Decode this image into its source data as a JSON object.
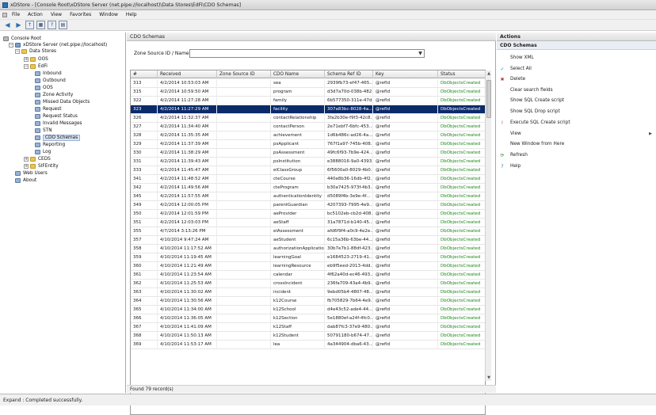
{
  "window": {
    "title": "xDStore - [Console Root\\xDStore Server (net.pipe://localhost)\\Data Stores\\EdFi\\CDO Schemas]"
  },
  "menu": [
    "File",
    "Action",
    "View",
    "Favorites",
    "Window",
    "Help"
  ],
  "tree": [
    {
      "label": "Console Root",
      "level": 0,
      "icon": "root"
    },
    {
      "label": "xDStore Server (net.pipe://localhost)",
      "level": 1,
      "icon": "server"
    },
    {
      "label": "Data Stores",
      "level": 2,
      "icon": "folder"
    },
    {
      "label": "OOS",
      "level": 3,
      "icon": "folder"
    },
    {
      "label": "EdFi",
      "level": 3,
      "icon": "folder"
    },
    {
      "label": "Inbound",
      "level": 4,
      "icon": "item"
    },
    {
      "label": "Outbound",
      "level": 4,
      "icon": "item"
    },
    {
      "label": "OOS",
      "level": 4,
      "icon": "item"
    },
    {
      "label": "Zone Activity",
      "level": 4,
      "icon": "item"
    },
    {
      "label": "Missed Data Objects",
      "level": 4,
      "icon": "item"
    },
    {
      "label": "Request",
      "level": 4,
      "icon": "item"
    },
    {
      "label": "Request Status",
      "level": 4,
      "icon": "item"
    },
    {
      "label": "Invalid Messages",
      "level": 4,
      "icon": "item"
    },
    {
      "label": "STN",
      "level": 4,
      "icon": "item"
    },
    {
      "label": "CDO Schemas",
      "level": 4,
      "icon": "item",
      "selected": true
    },
    {
      "label": "Reporting",
      "level": 4,
      "icon": "item"
    },
    {
      "label": "Log",
      "level": 4,
      "icon": "item"
    },
    {
      "label": "CEDS",
      "level": 3,
      "icon": "folder"
    },
    {
      "label": "SIFEntity",
      "level": 3,
      "icon": "folder"
    },
    {
      "label": "Web Users",
      "level": 2,
      "icon": "item"
    },
    {
      "label": "About",
      "level": 2,
      "icon": "item"
    }
  ],
  "center": {
    "title": "CDO Schemas",
    "filter_label": "Zone Source ID / Name:",
    "filter_value": "",
    "found": "Found 79 record(s)"
  },
  "grid": {
    "columns": [
      "#",
      "Received",
      "Zone Source ID",
      "CDO Name",
      "Schema Ref ID",
      "Key",
      "Status"
    ],
    "rows": [
      [
        "313",
        "4/2/2014 10:53:03 AM",
        "",
        "sea",
        "2939fb73-ef47-465...",
        "@refId",
        "DbObjectsCreated"
      ],
      [
        "315",
        "4/2/2014 10:59:50 AM",
        "",
        "program",
        "d3d7a70d-038b-482...",
        "@refId",
        "DbObjectsCreated"
      ],
      [
        "322",
        "4/2/2014 11:27:28 AM",
        "",
        "family",
        "6b577350-311e-47d...",
        "@refId",
        "DbObjectsCreated"
      ],
      [
        "323",
        "4/2/2014 11:27:29 AM",
        "",
        "facility",
        "307a83bc-8028-4a...",
        "@refId",
        "DbObjectsCreated"
      ],
      [
        "326",
        "4/2/2014 11:32:37 AM",
        "",
        "contactRelationship",
        "3fa2b30e-f9f3-42c8...",
        "@refId",
        "DbObjectsCreated"
      ],
      [
        "327",
        "4/2/2014 11:34:40 AM",
        "",
        "contactPerson",
        "2e71ebf7-6bfc-453...",
        "@refId",
        "DbObjectsCreated"
      ],
      [
        "328",
        "4/2/2014 11:35:35 AM",
        "",
        "achievement",
        "1d6b486c-ad26-4a...",
        "@refId",
        "DbObjectsCreated"
      ],
      [
        "329",
        "4/2/2014 11:37:39 AM",
        "",
        "psApplicant",
        "767f1a97-745b-408...",
        "@refId",
        "DbObjectsCreated"
      ],
      [
        "330",
        "4/2/2014 11:38:29 AM",
        "",
        "psAssessment",
        "49fc6f93-7b9e-424...",
        "@refId",
        "DbObjectsCreated"
      ],
      [
        "331",
        "4/2/2014 11:39:43 AM",
        "",
        "psInstitution",
        "e3888016-9a0-4393...",
        "@refId",
        "DbObjectsCreated"
      ],
      [
        "333",
        "4/2/2014 11:45:47 AM",
        "",
        "elClassGroup",
        "6f5600a0-8029-4b0...",
        "@refId",
        "DbObjectsCreated"
      ],
      [
        "341",
        "4/2/2014 11:48:52 AM",
        "",
        "cteCourse",
        "440e8b36-16db-4f2...",
        "@refId",
        "DbObjectsCreated"
      ],
      [
        "342",
        "4/2/2014 11:49:56 AM",
        "",
        "cteProgram",
        "b30a7425-973f-4b3...",
        "@refId",
        "DbObjectsCreated"
      ],
      [
        "345",
        "4/2/2014 11:57:55 AM",
        "",
        "authenticationIdentity",
        "d5089f4b-3e9e-4f...",
        "@refId",
        "DbObjectsCreated"
      ],
      [
        "349",
        "4/2/2014 12:00:05 PM",
        "",
        "parentGuardian",
        "4207393-7995-4e9...",
        "@refId",
        "DbObjectsCreated"
      ],
      [
        "350",
        "4/2/2014 12:01:59 PM",
        "",
        "aeProvider",
        "bc5102eb-cb2d-408...",
        "@refId",
        "DbObjectsCreated"
      ],
      [
        "351",
        "4/2/2014 12:03:03 PM",
        "",
        "aeStaff",
        "31a7871d-b140-45...",
        "@refId",
        "DbObjectsCreated"
      ],
      [
        "355",
        "4/7/2014 3:13:26 PM",
        "",
        "elAssessment",
        "afd6f9f4-a0c9-4e2e...",
        "@refId",
        "DbObjectsCreated"
      ],
      [
        "357",
        "4/10/2014 9:47:24 AM",
        "",
        "aeStudent",
        "6c15a36b-63be-44...",
        "@refId",
        "DbObjectsCreated"
      ],
      [
        "358",
        "4/10/2014 11:17:52 AM",
        "",
        "authorizationApplication",
        "30b7e7b1-88df-423...",
        "@refId",
        "DbObjectsCreated"
      ],
      [
        "359",
        "4/10/2014 11:19:45 AM",
        "",
        "learningGoal",
        "e1684523-2719-41...",
        "@refId",
        "DbObjectsCreated"
      ],
      [
        "360",
        "4/10/2014 11:21:49 AM",
        "",
        "learningResource",
        "eb9f5eed-2013-4dd...",
        "@refId",
        "DbObjectsCreated"
      ],
      [
        "361",
        "4/10/2014 11:23:54 AM",
        "",
        "calendar",
        "4f62a40d-ec46-493...",
        "@refId",
        "DbObjectsCreated"
      ],
      [
        "362",
        "4/10/2014 11:25:53 AM",
        "",
        "crossIncident",
        "236fa709-43a4-4b9...",
        "@refId",
        "DbObjectsCreated"
      ],
      [
        "363",
        "4/10/2014 11:30:02 AM",
        "",
        "incident",
        "9ebd05b4-4807-48...",
        "@refId",
        "DbObjectsCreated"
      ],
      [
        "364",
        "4/10/2014 11:30:56 AM",
        "",
        "k12Course",
        "fb705829-7b64-4e9...",
        "@refId",
        "DbObjectsCreated"
      ],
      [
        "365",
        "4/10/2014 11:34:00 AM",
        "",
        "k12School",
        "d4e43c52-ade4-44...",
        "@refId",
        "DbObjectsCreated"
      ],
      [
        "366",
        "4/10/2014 11:36:05 AM",
        "",
        "k12Section",
        "5e1880ef-a24f-4fc0...",
        "@refId",
        "DbObjectsCreated"
      ],
      [
        "367",
        "4/10/2014 11:41:09 AM",
        "",
        "k12Staff",
        "dab87fc3-37e9-480...",
        "@refId",
        "DbObjectsCreated"
      ],
      [
        "368",
        "4/10/2014 11:50:13 AM",
        "",
        "k12Student",
        "50791180-b674-47...",
        "@refId",
        "DbObjectsCreated"
      ],
      [
        "369",
        "4/10/2014 11:53:17 AM",
        "",
        "lea",
        "4a344904-dba6-43...",
        "@refId",
        "DbObjectsCreated"
      ]
    ],
    "selected_row": 3
  },
  "actions": {
    "title": "Actions",
    "section": "CDO Schemas",
    "items": [
      {
        "label": "Show XML",
        "icon": "",
        "submenu": false
      },
      {
        "label": "Select All",
        "icon": "check-icon",
        "submenu": false
      },
      {
        "label": "Delete",
        "icon": "delete-icon",
        "submenu": false
      },
      {
        "label": "Clear search fields",
        "icon": "",
        "submenu": false
      },
      {
        "label": "Show SQL Create script",
        "icon": "",
        "submenu": false
      },
      {
        "label": "Show SQL Drop script",
        "icon": "",
        "submenu": false
      },
      {
        "label": "Execute SQL Create script",
        "icon": "exclamation-icon",
        "submenu": false
      },
      {
        "label": "View",
        "icon": "",
        "submenu": true
      },
      {
        "label": "New Window from Here",
        "icon": "",
        "submenu": false
      },
      {
        "label": "Refresh",
        "icon": "refresh-icon",
        "submenu": false
      },
      {
        "label": "Help",
        "icon": "help-icon",
        "submenu": false
      }
    ]
  },
  "status": {
    "text": "Expand : Completed successfully."
  },
  "colors": {
    "selected_row": "#0b2a6a",
    "status_text": "#1a8a1a",
    "accent": "#2a6fb8"
  }
}
